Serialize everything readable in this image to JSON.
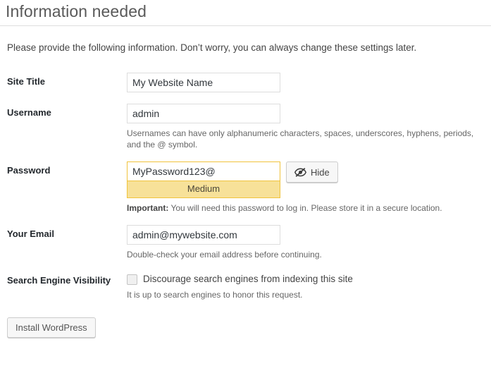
{
  "page": {
    "title": "Information needed",
    "intro": "Please provide the following information. Don’t worry, you can always change these settings later."
  },
  "fields": {
    "site_title": {
      "label": "Site Title",
      "value": "My Website Name"
    },
    "username": {
      "label": "Username",
      "value": "admin",
      "description": "Usernames can have only alphanumeric characters, spaces, underscores, hyphens, periods, and the @ symbol."
    },
    "password": {
      "label": "Password",
      "value": "MyPassword123@",
      "strength": "Medium",
      "hide_button": "Hide",
      "hide_icon": "eye-off-icon",
      "note_strong": "Important:",
      "note_text": " You will need this password to log in. Please store it in a secure location.",
      "strength_bar_color": "#f7e199",
      "strength_border_color": "#f0c33c"
    },
    "email": {
      "label": "Your Email",
      "value": "admin@mywebsite.com",
      "description": "Double-check your email address before continuing."
    },
    "search_visibility": {
      "label": "Search Engine Visibility",
      "checkbox_label": "Discourage search engines from indexing this site",
      "checked": false,
      "description": "It is up to search engines to honor this request."
    }
  },
  "submit": {
    "label": "Install WordPress"
  }
}
